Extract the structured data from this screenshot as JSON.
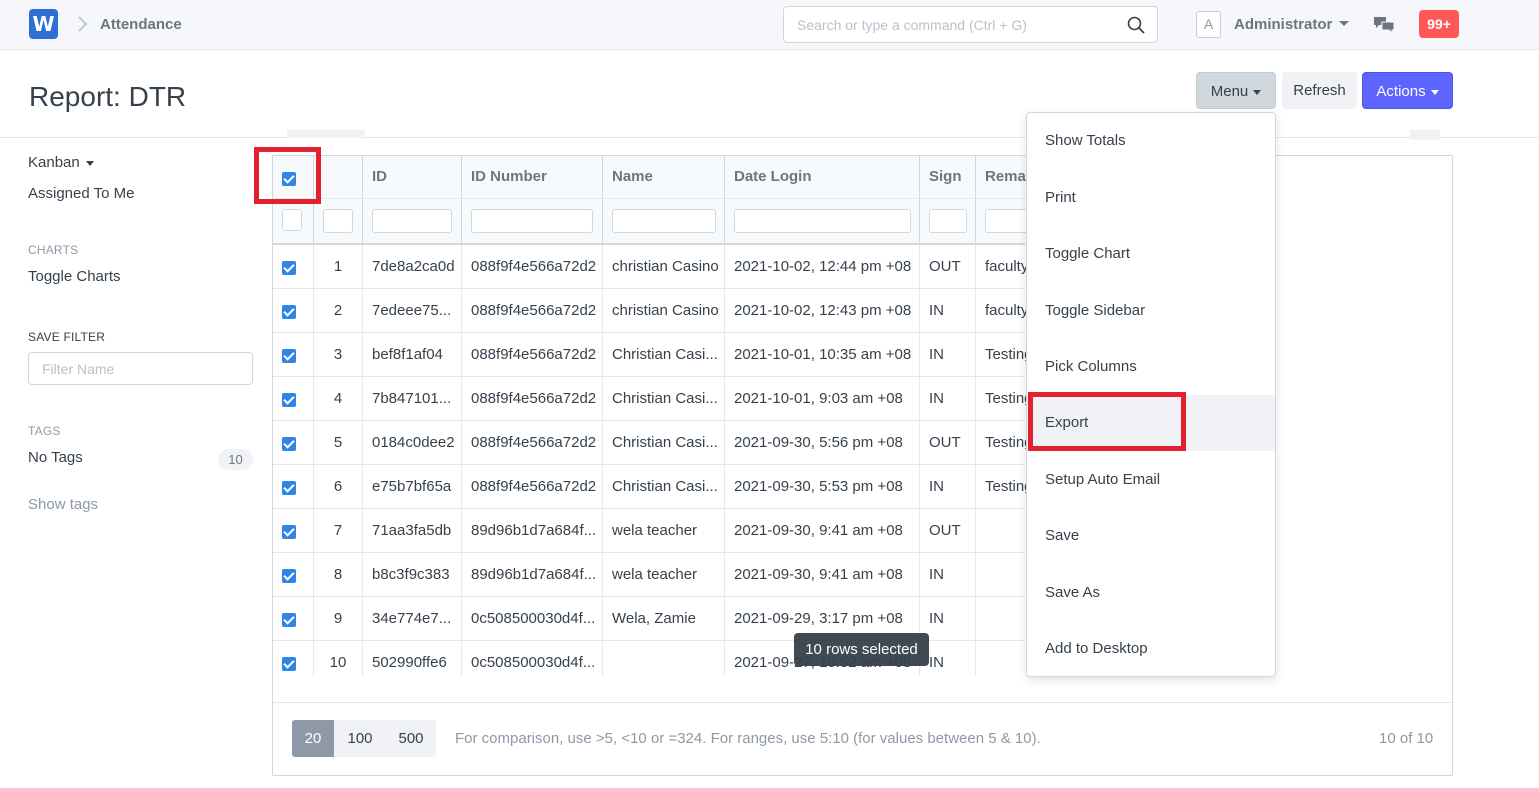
{
  "navbar": {
    "logo": "W",
    "breadcrumb": "Attendance",
    "search_placeholder": "Search or type a command (Ctrl + G)",
    "avatar_letter": "A",
    "user": "Administrator",
    "notifications": "99+"
  },
  "page": {
    "title": "Report: DTR",
    "menu_label": "Menu",
    "refresh_label": "Refresh",
    "actions_label": "Actions"
  },
  "sidebar": {
    "kanban": "Kanban",
    "assigned": "Assigned To Me",
    "charts_head": "CHARTS",
    "toggle_charts": "Toggle Charts",
    "save_filter_head": "SAVE FILTER",
    "filter_placeholder": "Filter Name",
    "tags_head": "TAGS",
    "no_tags": "No Tags",
    "tag_count": "10",
    "show_tags": "Show tags"
  },
  "table": {
    "headers": [
      "ID",
      "ID Number",
      "Name",
      "Date Login",
      "Sign",
      "Remarks"
    ],
    "rows": [
      {
        "n": "1",
        "id": "7de8a2ca0d",
        "idnum": "088f9f4e566a72d2",
        "name": "christian Casino",
        "date": "2021-10-02, 12:44 pm +08",
        "sign": "OUT",
        "remarks": "faculty"
      },
      {
        "n": "2",
        "id": "7edeee75...",
        "idnum": "088f9f4e566a72d2",
        "name": "christian Casino",
        "date": "2021-10-02, 12:43 pm +08",
        "sign": "IN",
        "remarks": "faculty"
      },
      {
        "n": "3",
        "id": "bef8f1af04",
        "idnum": "088f9f4e566a72d2",
        "name": "Christian Casi...",
        "date": "2021-10-01, 10:35 am +08",
        "sign": "IN",
        "remarks": "Testing"
      },
      {
        "n": "4",
        "id": "7b847101...",
        "idnum": "088f9f4e566a72d2",
        "name": "Christian Casi...",
        "date": "2021-10-01, 9:03 am +08",
        "sign": "IN",
        "remarks": "Testing"
      },
      {
        "n": "5",
        "id": "0184c0dee2",
        "idnum": "088f9f4e566a72d2",
        "name": "Christian Casi...",
        "date": "2021-09-30, 5:56 pm +08",
        "sign": "OUT",
        "remarks": "Testing"
      },
      {
        "n": "6",
        "id": "e75b7bf65a",
        "idnum": "088f9f4e566a72d2",
        "name": "Christian Casi...",
        "date": "2021-09-30, 5:53 pm +08",
        "sign": "IN",
        "remarks": "Testing"
      },
      {
        "n": "7",
        "id": "71aa3fa5db",
        "idnum": "89d96b1d7a684f...",
        "name": "wela teacher",
        "date": "2021-09-30, 9:41 am +08",
        "sign": "OUT",
        "remarks": ""
      },
      {
        "n": "8",
        "id": "b8c3f9c383",
        "idnum": "89d96b1d7a684f...",
        "name": "wela teacher",
        "date": "2021-09-30, 9:41 am +08",
        "sign": "IN",
        "remarks": ""
      },
      {
        "n": "9",
        "id": "34e774e7...",
        "idnum": "0c508500030d4f...",
        "name": "Wela, Zamie",
        "date": "2021-09-29, 3:17 pm +08",
        "sign": "IN",
        "remarks": ""
      },
      {
        "n": "10",
        "id": "502990ffe6",
        "idnum": "0c508500030d4f...",
        "name": "",
        "date": "2021-09-27, 10:52 am +08",
        "sign": "IN",
        "remarks": ""
      }
    ]
  },
  "menu": {
    "items": [
      "Show Totals",
      "Print",
      "Toggle Chart",
      "Toggle Sidebar",
      "Pick Columns",
      "Export",
      "Setup Auto Email",
      "Save",
      "Save As",
      "Add to Desktop"
    ],
    "highlighted": "Export"
  },
  "toast": "10 rows selected",
  "footer": {
    "page_sizes": [
      "20",
      "100",
      "500"
    ],
    "active_size": "20",
    "hint": "For comparison, use >5, <10 or =324. For ranges, use 5:10 (for values between 5 & 10).",
    "count": "10 of 10"
  },
  "colors": {
    "primary": "#5e64ff",
    "checkbox": "#2f86e6",
    "annotation_red": "#e3202d",
    "badge_red": "#ff5858"
  }
}
